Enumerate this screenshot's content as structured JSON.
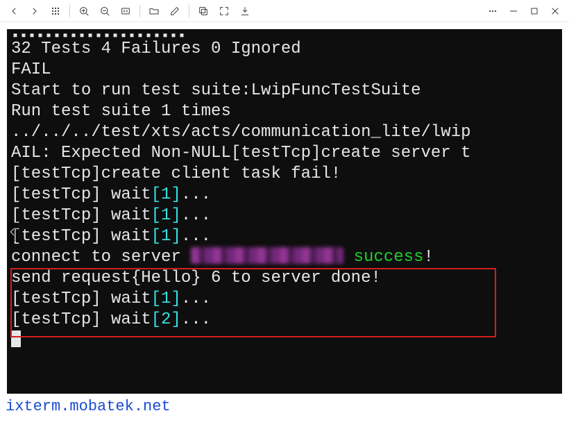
{
  "toolbar": {
    "back": "Back",
    "forward": "Forward",
    "apps": "Apps",
    "zoom_in": "Zoom In",
    "zoom_out": "Zoom Out",
    "fit": "1:1",
    "open": "Open Folder",
    "edit": "Edit",
    "copy": "Copies",
    "fullscreen": "Full Screen",
    "download": "Download",
    "more": "More",
    "minimize": "Minimize",
    "maximize": "Maximize",
    "close": "Close"
  },
  "terminal": {
    "lines": {
      "dots": "▪▪▪▪▪▪▪▪▪▪▪▪▪▪▪▪▪▪▪▪▪",
      "l1": "32 Tests 4 Failures 0 Ignored",
      "l2": "FAIL",
      "l3": "Start to run test suite:LwipFuncTestSuite",
      "l4": "Run test suite 1 times",
      "l5": "../../../test/xts/acts/communication_lite/lwip",
      "l6": "AIL: Expected Non-NULL[testTcp]create server t",
      "l7": "[testTcp]create client task fail!",
      "wait_prefix": "[testTcp] wait",
      "wait1_num": "[1]",
      "wait_suffix": "...",
      "connect_prefix": "connect to server ",
      "connect_success": " success",
      "bang": "!",
      "send_line": "send request{Hello} 6 to server done!",
      "wait2_num": "[2]"
    }
  },
  "footer": {
    "link_text": "ixterm.mobatek.net"
  }
}
